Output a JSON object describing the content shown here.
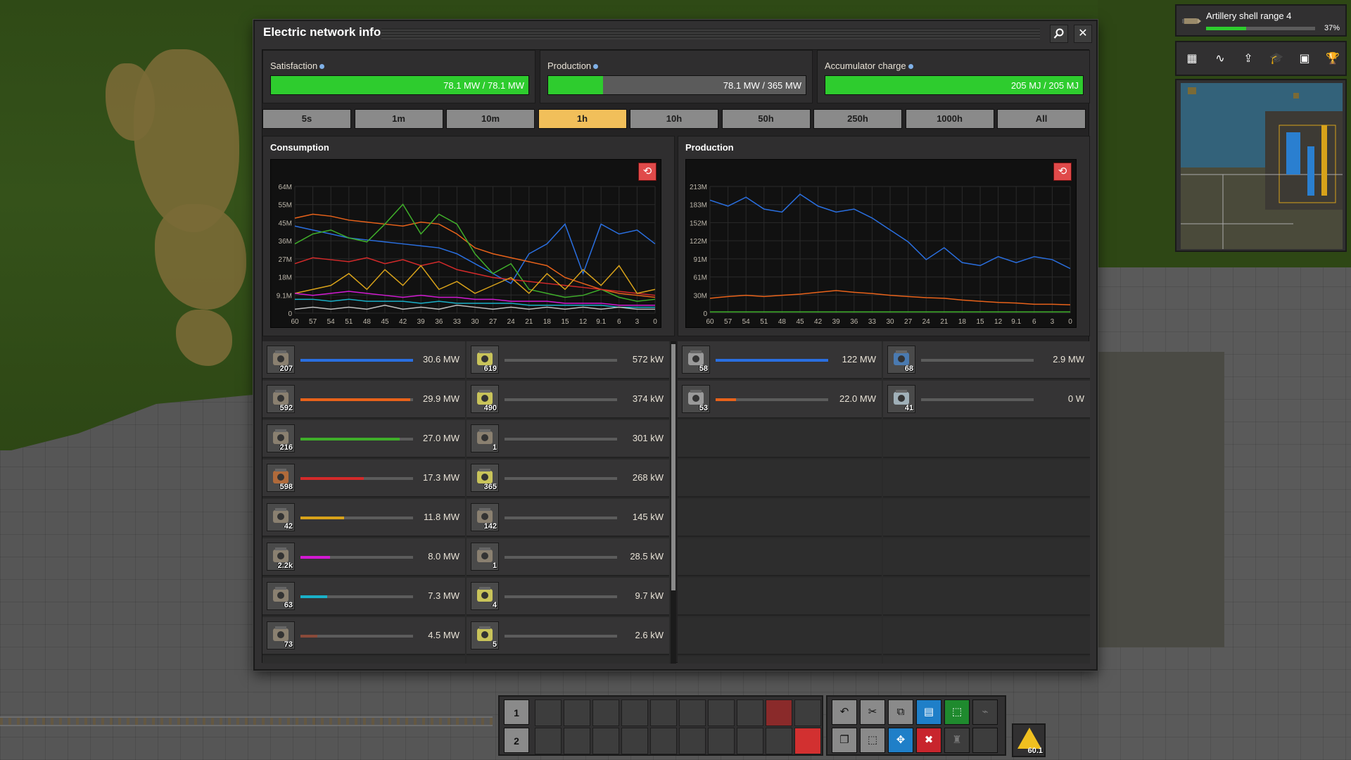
{
  "window": {
    "title": "Electric network info",
    "search_icon": "magnifier-icon",
    "close_label": "✕"
  },
  "stats": {
    "satisfaction": {
      "label": "Satisfaction",
      "value_text": "78.1 MW / 78.1 MW",
      "fill": 1.0
    },
    "production": {
      "label": "Production",
      "value_text": "78.1 MW / 365 MW",
      "fill": 0.214
    },
    "accumulator": {
      "label": "Accumulator charge",
      "value_text": "205 MJ / 205 MJ",
      "fill": 1.0
    }
  },
  "time_buttons": [
    "5s",
    "1m",
    "10m",
    "1h",
    "10h",
    "50h",
    "250h",
    "1000h",
    "All"
  ],
  "time_active": "1h",
  "consumption": {
    "title": "Consumption",
    "chart_data": {
      "type": "line",
      "x_ticks": [
        "60",
        "57",
        "54",
        "51",
        "48",
        "45",
        "42",
        "39",
        "36",
        "33",
        "30",
        "27",
        "24",
        "21",
        "18",
        "15",
        "12",
        "9.1",
        "6",
        "3",
        "0"
      ],
      "y_ticks": [
        "64M",
        "55M",
        "45M",
        "36M",
        "27M",
        "18M",
        "9.1M",
        "0"
      ],
      "ylim": [
        0,
        64
      ],
      "x": [
        60,
        57,
        54,
        51,
        48,
        45,
        42,
        39,
        36,
        33,
        30,
        27,
        24,
        21,
        18,
        15,
        12,
        9,
        6,
        3,
        0
      ],
      "series": [
        {
          "color": "#2a6fe0",
          "values": [
            44,
            42,
            40,
            38,
            37,
            36,
            35,
            34,
            33,
            30,
            25,
            20,
            15,
            30,
            35,
            45,
            20,
            45,
            40,
            42,
            35
          ]
        },
        {
          "color": "#e8621a",
          "values": [
            48,
            50,
            49,
            47,
            46,
            45,
            44,
            46,
            45,
            40,
            33,
            30,
            28,
            26,
            24,
            18,
            15,
            12,
            10,
            9,
            8
          ]
        },
        {
          "color": "#3fae2a",
          "values": [
            35,
            40,
            42,
            38,
            36,
            45,
            55,
            40,
            50,
            45,
            30,
            20,
            25,
            12,
            10,
            8,
            9,
            12,
            8,
            6,
            7
          ]
        },
        {
          "color": "#d42a2a",
          "values": [
            25,
            28,
            27,
            26,
            28,
            25,
            27,
            24,
            26,
            22,
            20,
            18,
            17,
            16,
            15,
            14,
            13,
            12,
            11,
            10,
            9
          ]
        },
        {
          "color": "#d8a21a",
          "values": [
            10,
            12,
            14,
            20,
            12,
            22,
            14,
            24,
            12,
            16,
            10,
            14,
            18,
            10,
            20,
            12,
            22,
            14,
            24,
            10,
            12
          ]
        },
        {
          "color": "#d21ad2",
          "values": [
            10,
            9,
            10,
            11,
            10,
            9,
            8,
            9,
            8,
            8,
            7,
            7,
            6,
            6,
            6,
            5,
            5,
            5,
            4,
            4,
            4
          ]
        },
        {
          "color": "#1ab0c8",
          "values": [
            7,
            7,
            6,
            7,
            6,
            6,
            6,
            5,
            6,
            5,
            5,
            5,
            5,
            4,
            4,
            4,
            4,
            4,
            3,
            3,
            3
          ]
        },
        {
          "color": "#c0c0c0",
          "values": [
            2,
            3,
            2,
            3,
            2,
            4,
            2,
            3,
            2,
            4,
            3,
            2,
            3,
            2,
            3,
            2,
            3,
            2,
            3,
            2,
            2
          ]
        }
      ]
    },
    "rows_left": [
      {
        "icon": "assembling-machine-icon",
        "count": "207",
        "value": "30.6 MW",
        "fill": 1.0,
        "color": "#2a6fe0"
      },
      {
        "icon": "electric-mining-drill-icon",
        "count": "592",
        "value": "29.9 MW",
        "fill": 0.977,
        "color": "#e8621a"
      },
      {
        "icon": "beacon-icon",
        "count": "216",
        "value": "27.0 MW",
        "fill": 0.882,
        "color": "#3fae2a"
      },
      {
        "icon": "electric-furnace-icon",
        "count": "598",
        "value": "17.3 MW",
        "fill": 0.565,
        "color": "#d42a2a"
      },
      {
        "icon": "oil-refinery-icon",
        "count": "42",
        "value": "11.8 MW",
        "fill": 0.386,
        "color": "#d8a21a"
      },
      {
        "icon": "laser-turret-icon",
        "count": "2.2k",
        "value": "8.0 MW",
        "fill": 0.261,
        "color": "#d21ad2"
      },
      {
        "icon": "lab-icon",
        "count": "63",
        "value": "7.3 MW",
        "fill": 0.239,
        "color": "#1ab0c8"
      },
      {
        "icon": "chemical-plant-icon",
        "count": "73",
        "value": "4.5 MW",
        "fill": 0.147,
        "color": "#8a4a3a"
      }
    ],
    "rows_right": [
      {
        "icon": "fast-inserter-icon",
        "count": "619",
        "value": "572 kW",
        "fill": 0.0
      },
      {
        "icon": "long-handed-inserter-icon",
        "count": "490",
        "value": "374 kW",
        "fill": 0.0
      },
      {
        "icon": "rocket-silo-icon",
        "count": "1",
        "value": "301 kW",
        "fill": 0.0
      },
      {
        "icon": "stack-inserter-icon",
        "count": "365",
        "value": "268 kW",
        "fill": 0.0
      },
      {
        "icon": "pumpjack-icon",
        "count": "142",
        "value": "145 kW",
        "fill": 0.0
      },
      {
        "icon": "centrifuge-icon",
        "count": "1",
        "value": "28.5 kW",
        "fill": 0.0
      },
      {
        "icon": "filter-inserter-icon",
        "count": "4",
        "value": "9.7 kW",
        "fill": 0.0
      },
      {
        "icon": "stack-filter-inserter-icon",
        "count": "5",
        "value": "2.6 kW",
        "fill": 0.0
      }
    ]
  },
  "production": {
    "title": "Production",
    "chart_data": {
      "type": "line",
      "x_ticks": [
        "60",
        "57",
        "54",
        "51",
        "48",
        "45",
        "42",
        "39",
        "36",
        "33",
        "30",
        "27",
        "24",
        "21",
        "18",
        "15",
        "12",
        "9.1",
        "6",
        "3",
        "0"
      ],
      "y_ticks": [
        "213M",
        "183M",
        "152M",
        "122M",
        "91M",
        "61M",
        "30M",
        "0"
      ],
      "ylim": [
        0,
        213
      ],
      "x": [
        60,
        57,
        54,
        51,
        48,
        45,
        42,
        39,
        36,
        33,
        30,
        27,
        24,
        21,
        18,
        15,
        12,
        9,
        6,
        3,
        0
      ],
      "series": [
        {
          "color": "#2a6fe0",
          "values": [
            190,
            180,
            195,
            175,
            170,
            200,
            180,
            170,
            175,
            160,
            140,
            120,
            90,
            110,
            85,
            80,
            95,
            85,
            95,
            90,
            75
          ]
        },
        {
          "color": "#e8621a",
          "values": [
            25,
            28,
            30,
            28,
            30,
            32,
            35,
            38,
            35,
            33,
            30,
            28,
            26,
            25,
            22,
            20,
            18,
            17,
            15,
            15,
            14
          ]
        },
        {
          "color": "#3fae2a",
          "values": [
            2,
            2,
            2,
            2,
            2,
            2,
            2,
            2,
            2,
            2,
            2,
            2,
            2,
            2,
            2,
            2,
            2,
            2,
            2,
            2,
            2
          ]
        }
      ]
    },
    "rows_left": [
      {
        "icon": "steam-turbine-icon",
        "count": "58",
        "value": "122 MW",
        "fill": 1.0,
        "color": "#2a6fe0"
      },
      {
        "icon": "steam-engine-icon",
        "count": "53",
        "value": "22.0 MW",
        "fill": 0.18,
        "color": "#e8621a"
      }
    ],
    "rows_right": [
      {
        "icon": "solar-panel-icon",
        "count": "68",
        "value": "2.9 MW",
        "fill": 0.0
      },
      {
        "icon": "accumulator-icon",
        "count": "41",
        "value": "0 W",
        "fill": 0.0
      }
    ]
  },
  "research": {
    "title": "Artillery shell range 4",
    "percent_text": "37%",
    "fill": 0.37
  },
  "shortcuts": [
    "map-icon",
    "stats-icon",
    "tech-icon",
    "research-icon",
    "train-icon",
    "achievements-icon"
  ],
  "hotbar": {
    "row1_label": "1",
    "row2_label": "2"
  },
  "alerts": {
    "count": "60.1"
  }
}
